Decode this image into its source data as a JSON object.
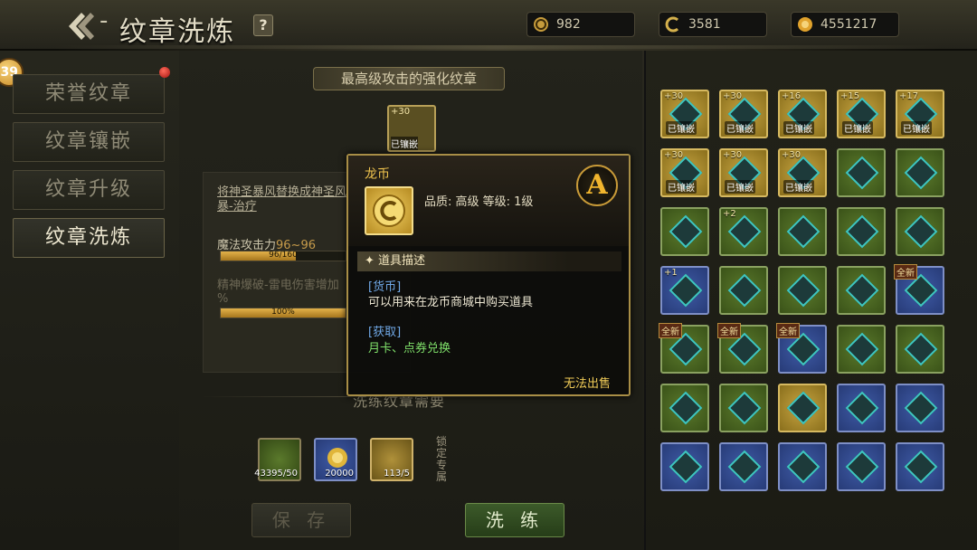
{
  "header": {
    "title": "纹章洗炼",
    "help_label": "?",
    "currencies": [
      {
        "name": "dragon-coin",
        "value": "982"
      },
      {
        "name": "gold-coin",
        "value": "3581"
      },
      {
        "name": "silver-coin",
        "value": "4551217"
      }
    ]
  },
  "sidebar": {
    "level_badge": "39",
    "items": [
      {
        "label": "荣誉纹章"
      },
      {
        "label": "纹章镶嵌"
      },
      {
        "label": "纹章升级"
      },
      {
        "label": "纹章洗炼"
      }
    ]
  },
  "main": {
    "section_title": "最高级攻击的强化纹章",
    "slot_plus": "+30",
    "slot_tag": "已镶嵌",
    "description": "将神圣暴风替换成神圣风暴-治疗",
    "stats": [
      {
        "name": "魔法攻击力",
        "range": "96~96",
        "bar_text": "96/160",
        "fill": 0.6
      },
      {
        "name": "精神爆破-雷电伤害增加",
        "range": "%",
        "bar_text": "100%",
        "fill": 1.0
      }
    ],
    "requirement_title": "洗练纹章需要",
    "materials": [
      {
        "count": "43395/50",
        "color": "green"
      },
      {
        "count": "20000",
        "color": "blue"
      },
      {
        "count": "113/5",
        "color": "gold"
      }
    ],
    "lock_text": "锁定专属",
    "save_label": "保 存",
    "wash_label": "洗 练"
  },
  "tooltip": {
    "name": "龙币",
    "meta": "品质: 高级   等级: 1级",
    "grade": "A",
    "section_label": "道具描述",
    "category_label": "[货币]",
    "category_desc": "可以用来在龙币商城中购买道具",
    "source_label": "[获取]",
    "source_desc": "月卡、点券兑换",
    "no_sell": "无法出售"
  },
  "inventory": {
    "rows": [
      [
        {
          "t": "gold",
          "p": "+30",
          "tag": "已镶嵌"
        },
        {
          "t": "gold",
          "p": "+30",
          "tag": "已镶嵌"
        },
        {
          "t": "gold",
          "p": "+16",
          "tag": "已镶嵌"
        },
        {
          "t": "gold",
          "p": "+15",
          "tag": "已镶嵌"
        },
        {
          "t": "gold",
          "p": "+17",
          "tag": "已镶嵌"
        }
      ],
      [
        {
          "t": "gold",
          "p": "+30",
          "tag": "已镶嵌"
        },
        {
          "t": "gold",
          "p": "+30",
          "tag": "已镶嵌"
        },
        {
          "t": "gold",
          "p": "+30",
          "tag": "已镶嵌"
        },
        {
          "t": "green"
        },
        {
          "t": "green"
        }
      ],
      [
        {
          "t": "green"
        },
        {
          "t": "green",
          "p": "+2"
        },
        {
          "t": "green"
        },
        {
          "t": "green"
        },
        {
          "t": "green"
        }
      ],
      [
        {
          "t": "blue",
          "p": "+1"
        },
        {
          "t": "green"
        },
        {
          "t": "green"
        },
        {
          "t": "green"
        },
        {
          "t": "blue",
          "r": "全新"
        }
      ],
      [
        {
          "t": "green",
          "r": "全新"
        },
        {
          "t": "green",
          "r": "全新"
        },
        {
          "t": "blue",
          "r": "全新"
        },
        {
          "t": "green"
        },
        {
          "t": "green"
        }
      ],
      [
        {
          "t": "green"
        },
        {
          "t": "green"
        },
        {
          "t": "gold"
        },
        {
          "t": "blue"
        },
        {
          "t": "blue"
        }
      ],
      [
        {
          "t": "blue"
        },
        {
          "t": "blue"
        },
        {
          "t": "blue"
        },
        {
          "t": "blue"
        },
        {
          "t": "blue"
        }
      ]
    ]
  }
}
